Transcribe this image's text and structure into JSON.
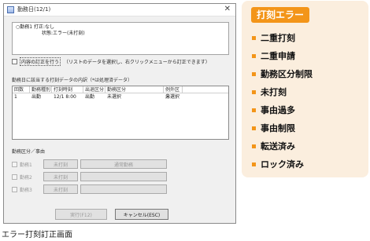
{
  "window": {
    "title": "勤務日(12/1)",
    "close": "✕"
  },
  "status": {
    "line1": "○勤務1 打正:なし",
    "line2": "状態:エラー(未打刻)"
  },
  "correct": {
    "checkbox_label": "内容の訂正を行う",
    "hint": "（リストのデータを選択し、右クリックメニューから訂正できます）"
  },
  "list": {
    "caption": "勤務日に該当する打刻データの内訳（*は処理済データ）",
    "headers": [
      "回数",
      "勤務種別",
      "打刻時刻",
      "出退区分",
      "勤務区分",
      "例外区分"
    ],
    "rows": [
      [
        "1",
        "出勤",
        "12/1 8:00",
        "出勤",
        "未選択",
        "未選択"
      ]
    ]
  },
  "group": {
    "title": "勤務区分／事由",
    "rows": [
      {
        "label": "勤務1",
        "button": "未打刻",
        "wide": "通常勤務"
      },
      {
        "label": "勤務2",
        "button": "未打刻",
        "wide": ""
      },
      {
        "label": "勤務3",
        "button": "未打刻",
        "wide": ""
      }
    ]
  },
  "footer": {
    "execute": "実行(F12)",
    "cancel": "キャンセル(ESC)"
  },
  "caption": "エラー打刻訂正画面",
  "panel": {
    "badge": "打刻エラー",
    "items": [
      "二重打刻",
      "二重申請",
      "勤務区分制限",
      "未打刻",
      "事由過多",
      "事由制限",
      "転送済み",
      "ロック済み"
    ]
  },
  "colors": {
    "accent": "#f39519",
    "panel_bg": "#fbeede"
  }
}
